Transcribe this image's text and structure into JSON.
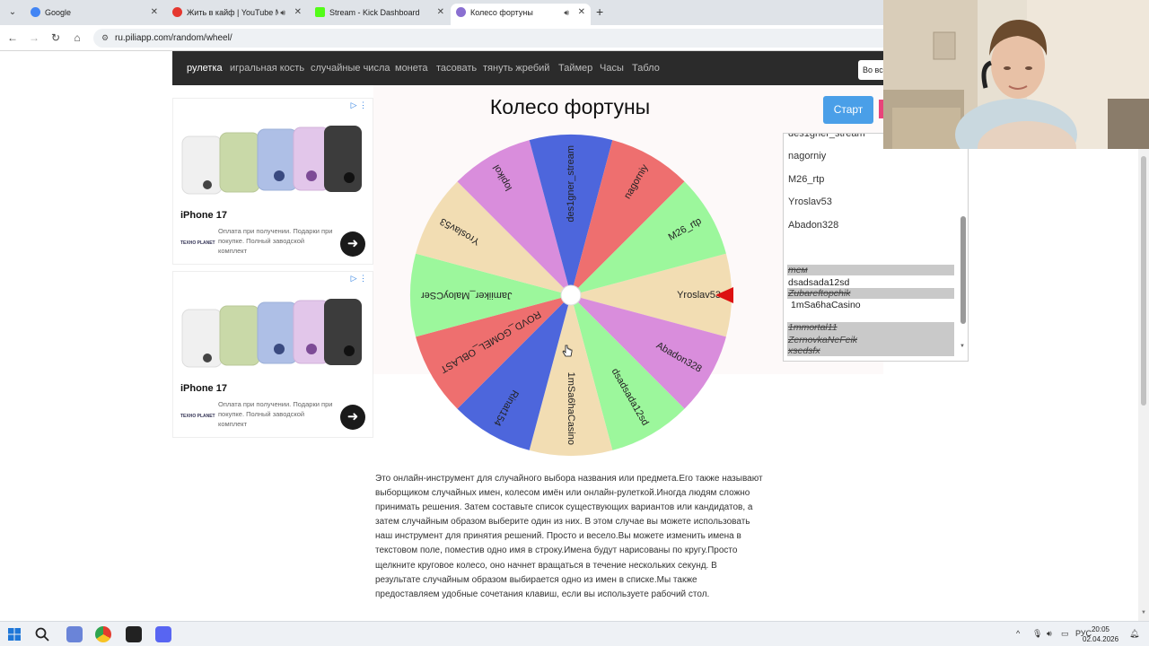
{
  "browser": {
    "tabs": [
      {
        "label": "Google",
        "icon_color": "#4285f4"
      },
      {
        "label": "Жить в кайф | YouTube Mu",
        "icon_color": "#e5372f"
      },
      {
        "label": "Stream - Kick Dashboard",
        "icon_color": "#53fc18"
      },
      {
        "label": "Колесо фортуны",
        "icon_color": "#8a6fd1"
      }
    ],
    "url": "ru.piliapp.com/random/wheel/"
  },
  "nav": {
    "items": [
      "рулетка",
      "игральная кость",
      "случайные числа",
      "монета",
      "тасовать",
      "тянуть жребий",
      "Таймер",
      "Часы",
      "Табло"
    ],
    "lang_button": "Во все"
  },
  "ads": [
    {
      "title": "iPhone 17",
      "text": "Оплата при получении. Подарки при покупке. Полный заводской комплект",
      "brand": "ТЕХНО PLANET"
    },
    {
      "title": "iPhone 17",
      "text": "Оплата при получении. Подарки при покупке. Полный заводской комплект",
      "brand": "ТЕХНО PLANET"
    }
  ],
  "page": {
    "title": "Колесо фортуны",
    "start_button": "Старт"
  },
  "wheel": {
    "segments": [
      {
        "name": "Yroslav53",
        "color": "#f2ddb3"
      },
      {
        "name": "Abadon328",
        "color": "#d98ddc"
      },
      {
        "name": "dsadsada12sd",
        "color": "#9cf79c"
      },
      {
        "name": "1mSa6haCasino",
        "color": "#f2ddb3"
      },
      {
        "name": "Rinat154",
        "color": "#4d66dc"
      },
      {
        "name": "ROVD_GOMEL_OBLAST",
        "color": "#ee6f6f"
      },
      {
        "name": "Jamiiker_MaloyCSer",
        "color": "#9cf79c"
      },
      {
        "name": "Yroslav53",
        "color": "#f2ddb3"
      },
      {
        "name": "lopikol",
        "color": "#d98ddc"
      },
      {
        "name": "des1gner_stream",
        "color": "#4d66dc"
      },
      {
        "name": "nagorniy",
        "color": "#ee6f6f"
      },
      {
        "name": "M26_rtp",
        "color": "#9cf79c"
      }
    ],
    "pointer_color": "#dd1111"
  },
  "names_list": {
    "names": [
      "des1gner_stream",
      "nagorniy",
      "M26_rtp",
      "Yroslav53",
      "Abadon328"
    ],
    "removed": [
      {
        "text": "тем",
        "struck": true
      },
      {
        "text": "dsadsada12sd",
        "struck": false
      },
      {
        "text": "Zubareftopchik",
        "struck": true
      },
      {
        "text": "1mSa6haCasino",
        "struck": false
      },
      {
        "text": "1mmortal11",
        "struck": true
      },
      {
        "text": "ZernovkaNeFeik",
        "struck": true
      },
      {
        "text": "xsedsfx",
        "struck": true
      }
    ]
  },
  "description": "Это онлайн-инструмент для случайного выбора названия или предмета.Его также называют выборщиком случайных имен, колесом имён или онлайн-рулеткой.Иногда людям сложно принимать решения. Затем составьте список существующих вариантов или кандидатов, а затем случайным образом выберите один из них. В этом случае вы можете использовать наш инструмент для принятия решений. Просто и весело.Вы можете изменить имена в текстовом поле, поместив одно имя в строку.Имена будут нарисованы по кругу.Просто щелкните круговое колесо, оно начнет вращаться в течение нескольких секунд. В результате случайным образом выбирается одно из имен в списке.Мы также предоставляем удобные сочетания клавиш, если вы используете рабочий стол.",
  "taskbar": {
    "lang": "РУС",
    "time": "20:05",
    "date": "02.04.2026"
  }
}
